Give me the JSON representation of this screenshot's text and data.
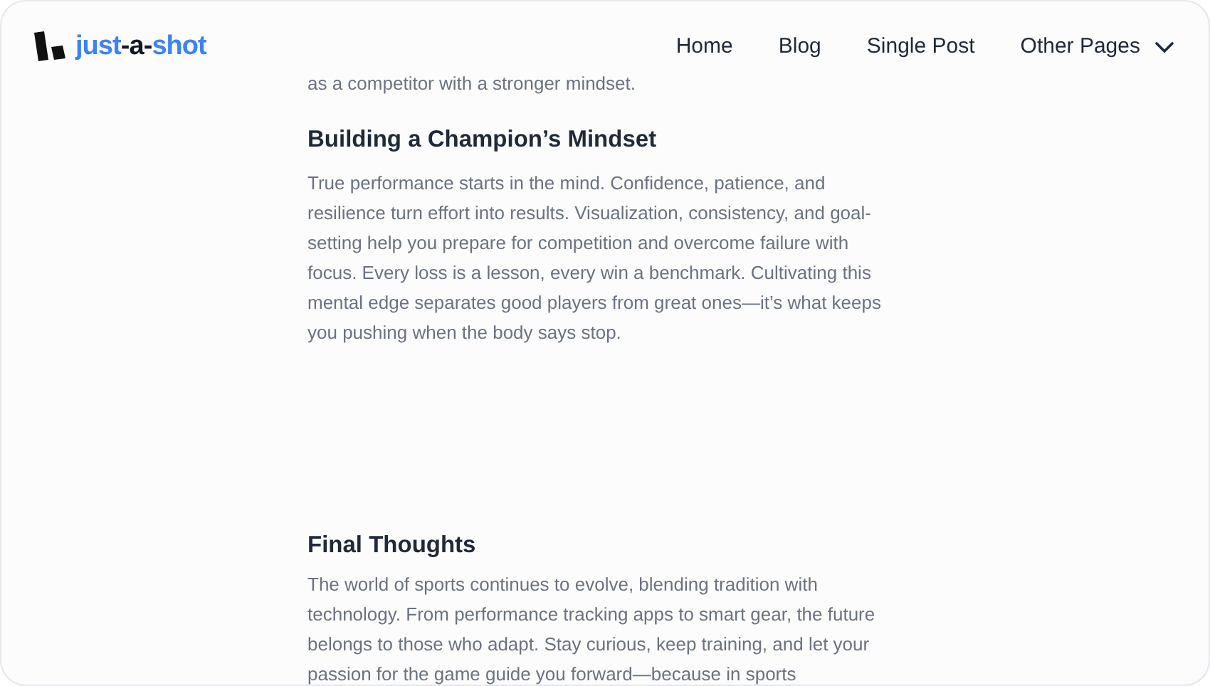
{
  "header": {
    "logo": {
      "parts": [
        {
          "text": "just",
          "accent": true
        },
        {
          "text": "-a-",
          "accent": false
        },
        {
          "text": "shot",
          "accent": true
        }
      ]
    },
    "nav": [
      {
        "label": "Home",
        "dropdown": false
      },
      {
        "label": "Blog",
        "dropdown": false
      },
      {
        "label": "Single Post",
        "dropdown": false
      },
      {
        "label": "Other Pages",
        "dropdown": true
      }
    ]
  },
  "article": {
    "intro_tail": "as a competitor with a stronger mindset.",
    "sections": [
      {
        "heading": "Building a Champion’s Mindset",
        "body": "True performance starts in the mind. Confidence, patience, and resilience turn effort into results. Visualization, consistency, and goal-setting help you prepare for competition and overcome failure with focus. Every loss is a lesson, every win a benchmark. Cultivating this mental edge separates good players from great ones—it’s what keeps you pushing when the body says stop."
      },
      {
        "heading": "Final Thoughts",
        "body": "The world of sports continues to evolve, blending tradition with technology. From performance tracking apps to smart gear, the future belongs to those who adapt. Stay curious, keep training, and let your passion for the game guide you forward—because in sports"
      }
    ]
  }
}
